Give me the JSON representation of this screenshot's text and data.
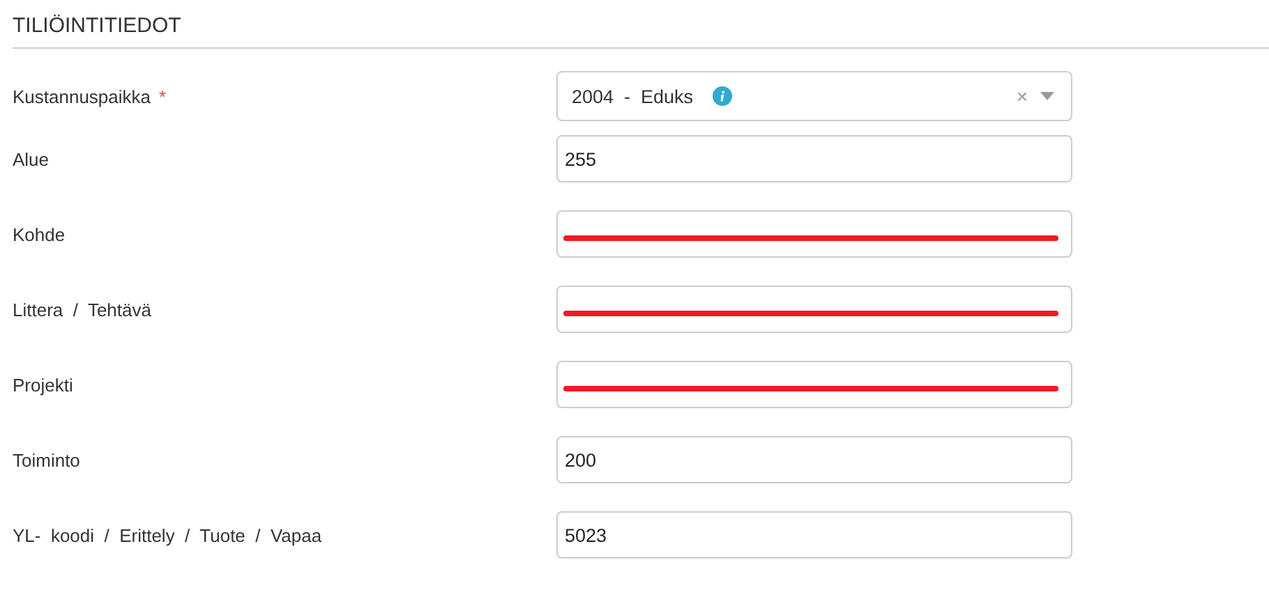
{
  "section": {
    "title": "TILIÖINTITIEDOT"
  },
  "fields": [
    {
      "label": "Kustannuspaikka",
      "required_mark": "*",
      "kind": "select",
      "value": "2004  -  Eduks",
      "clear": "×"
    },
    {
      "label": "Alue",
      "kind": "input",
      "value": "255",
      "redacted": false
    },
    {
      "label": "Kohde",
      "kind": "input",
      "redacted": true
    },
    {
      "label": "Littera  /  Tehtävä",
      "kind": "input",
      "redacted": true
    },
    {
      "label": "Projekti",
      "kind": "input",
      "redacted": true
    },
    {
      "label": "Toiminto",
      "kind": "input",
      "value": "200",
      "redacted": false
    },
    {
      "label": "YL-  koodi  /  Erittely  /  Tuote  /  Vapaa",
      "kind": "input",
      "value": "5023",
      "redacted": false
    }
  ]
}
